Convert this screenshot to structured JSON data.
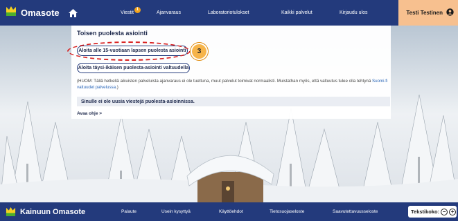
{
  "header": {
    "brand": "Omasote",
    "nav": [
      {
        "label": "Viestit",
        "badge": "1"
      },
      {
        "label": "Ajanvaraus"
      },
      {
        "label": "Laboratoriotulokset"
      },
      {
        "label": "Kaikki palvelut"
      },
      {
        "label": "Kirjaudu ulos"
      }
    ],
    "user": "Testi Testinen"
  },
  "main": {
    "title": "Toisen puolesta asiointi",
    "button_child": "Aloita alle 15-vuotiaan lapsen puolesta asiointi",
    "step_marker": "3",
    "button_adult": "Aloita täysi-ikäisen puolesta-asiointi valtuudella",
    "note_text": "(HUOM: Tällä hetkellä aikuisten palveluista ajanvaraus ei ole tuettuna, muut palvelut toimivat normaalisti. Muistathan myös, että valtuutus tulee olla tehtynä ",
    "note_link": "Suomi.fi valtuudet palvelussa",
    "note_end": ".)",
    "notice": "Sinulle ei ole uusia viestejä puolesta-asioinnissa.",
    "help_link": "Avaa ohje >"
  },
  "footer": {
    "brand": "Kainuun Omasote",
    "links": [
      "Palaute",
      "Usein kysyttyä",
      "Käyttöehdot",
      "Tietosuojaseloste",
      "Saavutettavuusseloste"
    ],
    "textsize_label": "Tekstikoko:",
    "minus": "−",
    "plus": "+"
  },
  "colors": {
    "nav_bg": "#233a7c",
    "user_bg": "#f7c08f",
    "logo_yellow": "#f5d020",
    "logo_green": "#4caf2e",
    "highlight_red": "#d81f1f",
    "step_orange": "#f6b44a"
  },
  "icons": {
    "logo": "crown-logo-icon",
    "home": "home-icon",
    "user": "user-icon"
  }
}
